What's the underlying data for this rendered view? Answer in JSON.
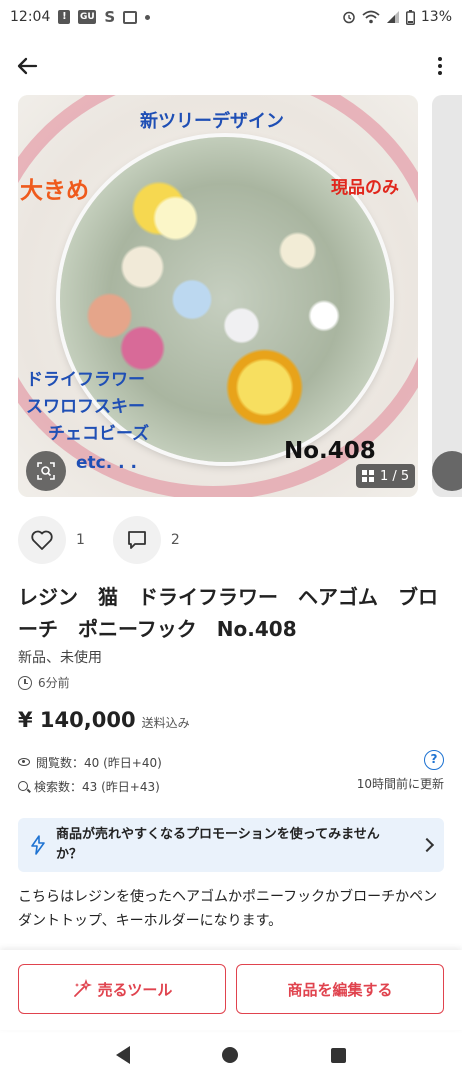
{
  "status_bar": {
    "time": "12:04",
    "icons": [
      "alert-icon",
      "gu-icon",
      "s-icon",
      "bag-icon",
      "dot-icon"
    ],
    "battery": "13%",
    "right_icons": [
      "alarm-icon",
      "wifi-icon",
      "signal-icon",
      "battery-icon"
    ]
  },
  "photo": {
    "overlay_top": "新ツリーデザイン",
    "overlay_big": "大きめ",
    "overlay_only": "現品のみ",
    "overlay_line1": "ドライフラワー",
    "overlay_line2": "スワロフスキー",
    "overlay_line3": "チェコビーズ",
    "overlay_etc": "etc. . .",
    "overlay_no": "No.408",
    "page_counter": "1 / 5"
  },
  "social": {
    "likes": "1",
    "comments": "2"
  },
  "item": {
    "title": "レジン　猫　ドライフラワー　ヘアゴム　ブローチ　ポニーフック　No.408",
    "condition": "新品、未使用",
    "posted": "6分前",
    "price": "¥ 140,000",
    "shipping": "送料込み",
    "views": "閲覧数：40 (昨日+40)",
    "searches": "検索数：43 (昨日+43)",
    "updated": "10時間前に更新",
    "description": "こちらはレジンを使ったヘアゴムかポニーフックかブローチかペンダントトップ、キーホルダーになります。"
  },
  "promo": {
    "text": "商品が売れやすくなるプロモーションを使ってみませんか？"
  },
  "actions": {
    "sell_tools": "売るツール",
    "edit_item": "商品を編集する"
  },
  "colors": {
    "accent": "#e0434e",
    "link": "#1e73d2",
    "promo_bg": "#eaf2fb"
  }
}
